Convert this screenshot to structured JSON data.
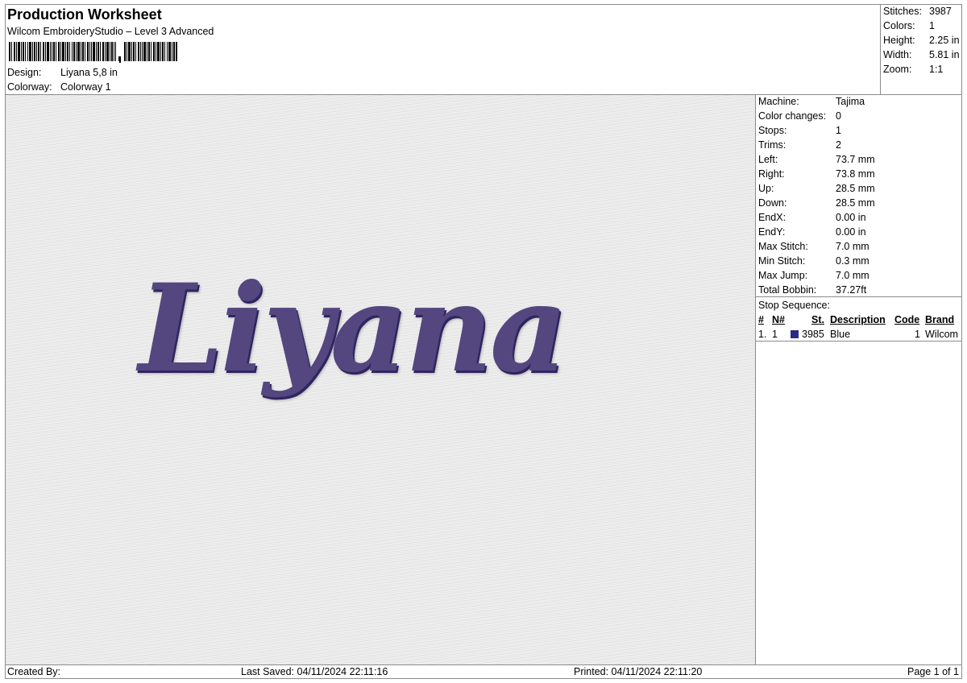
{
  "header": {
    "title": "Production Worksheet",
    "subtitle": "Wilcom EmbroideryStudio – Level 3 Advanced",
    "design_label": "Design:",
    "design_value": "Liyana 5,8 in",
    "colorway_label": "Colorway:",
    "colorway_value": "Colorway 1"
  },
  "summary": {
    "stitches_label": "Stitches:",
    "stitches": "3987",
    "colors_label": "Colors:",
    "colors": "1",
    "height_label": "Height:",
    "height": "2.25 in",
    "width_label": "Width:",
    "width": "5.81 in",
    "zoom_label": "Zoom:",
    "zoom": "1:1"
  },
  "preview": {
    "design_text": "Liyana",
    "thread_color": "#54477f",
    "fabric_color": "#e9e9e9"
  },
  "machine": {
    "rows": [
      {
        "label": "Machine:",
        "value": "Tajima"
      },
      {
        "label": "Color changes:",
        "value": "0"
      },
      {
        "label": "Stops:",
        "value": "1"
      },
      {
        "label": "Trims:",
        "value": "2"
      },
      {
        "label": "Left:",
        "value": "73.7 mm"
      },
      {
        "label": "Right:",
        "value": "73.8 mm"
      },
      {
        "label": "Up:",
        "value": "28.5 mm"
      },
      {
        "label": "Down:",
        "value": "28.5 mm"
      },
      {
        "label": "EndX:",
        "value": "0.00 in"
      },
      {
        "label": "EndY:",
        "value": "0.00 in"
      },
      {
        "label": "Max Stitch:",
        "value": "7.0 mm"
      },
      {
        "label": "Min Stitch:",
        "value": "0.3 mm"
      },
      {
        "label": "Max Jump:",
        "value": "7.0 mm"
      },
      {
        "label": "Total Bobbin:",
        "value": "37.27ft"
      }
    ]
  },
  "stop_sequence": {
    "title": "Stop Sequence:",
    "headers": {
      "num": "#",
      "n_num": "N#",
      "st": "St.",
      "description": "Description",
      "code": "Code",
      "brand": "Brand"
    },
    "rows": [
      {
        "num": "1.",
        "n_num": "1",
        "swatch_color": "#2a2a84",
        "st": "3985",
        "description": "Blue",
        "code": "1",
        "brand": "Wilcom"
      }
    ]
  },
  "footer": {
    "created_by": "Created By:",
    "last_saved": "Last Saved: 04/11/2024 22:11:16",
    "printed": "Printed: 04/11/2024 22:11:20",
    "page": "Page 1 of 1"
  }
}
